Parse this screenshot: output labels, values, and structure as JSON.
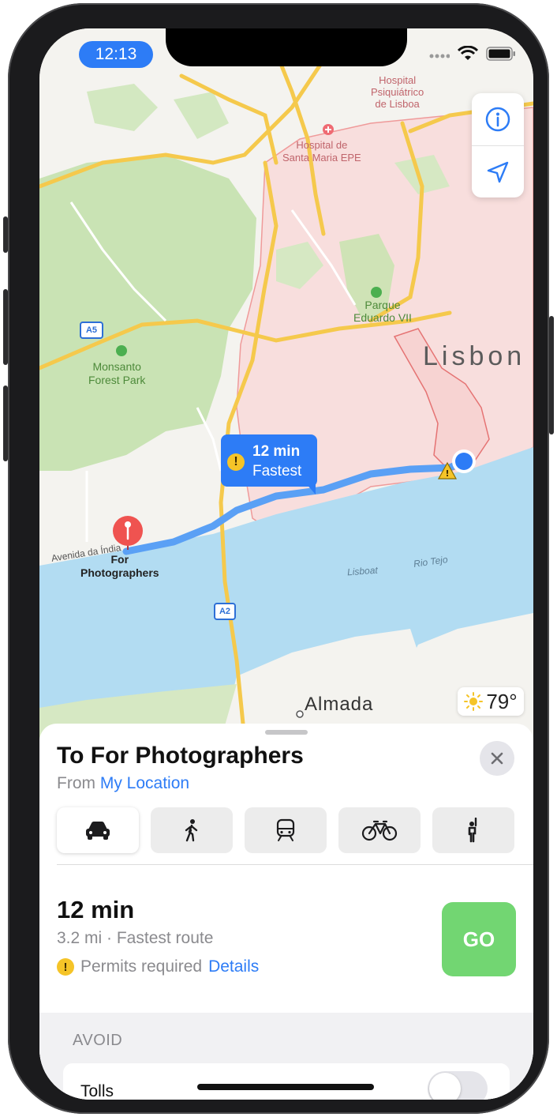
{
  "status_bar": {
    "time": "12:13"
  },
  "map": {
    "labels": {
      "hospital_psiquiatrico": "Hospital Psiquiátrico de Lisboa",
      "hospital_psiquiatrico_l1": "Hospital",
      "hospital_psiquiatrico_l2": "Psiquiátrico",
      "hospital_psiquiatrico_l3": "de Lisboa",
      "hospital_santa_maria_l1": "Hospital de",
      "hospital_santa_maria_l2": "Santa Maria EPE",
      "parque_l1": "Parque",
      "parque_l2": "Eduardo VII",
      "lisbon": "Lisbon",
      "monsanto_l1": "Monsanto",
      "monsanto_l2": "Forest Park",
      "avenida": "Avenida da Índia",
      "dest_l1": "For",
      "dest_l2": "Photographers",
      "lisboat": "Lisboat",
      "rio_tejo": "Rio Tejo",
      "almada": "Almada",
      "a5": "A5",
      "a2": "A2"
    },
    "route_callout": {
      "time": "12 min",
      "label": "Fastest"
    },
    "weather": {
      "temperature": "79°",
      "icon": "sun-icon"
    },
    "controls": {
      "info_icon": "info-icon",
      "location_icon": "location-arrow-icon"
    }
  },
  "sheet": {
    "title": "To For Photographers",
    "from_prefix": "From",
    "from_link": "My Location",
    "modes": [
      {
        "name": "drive",
        "icon": "car-icon",
        "active": true
      },
      {
        "name": "walk",
        "icon": "walk-icon",
        "active": false
      },
      {
        "name": "transit",
        "icon": "train-icon",
        "active": false
      },
      {
        "name": "cycle",
        "icon": "bicycle-icon",
        "active": false
      },
      {
        "name": "rideshare",
        "icon": "hail-icon",
        "active": false
      }
    ],
    "route": {
      "time": "12 min",
      "summary": "3.2 mi · Fastest route",
      "permit_text": "Permits required",
      "permit_link": "Details",
      "go_label": "GO"
    },
    "avoid": {
      "header": "AVOID",
      "tolls_label": "Tolls",
      "tolls_on": false
    }
  },
  "colors": {
    "accent_blue": "#2d7cf6",
    "go_green": "#72d672",
    "warning_yellow": "#f5c428",
    "water": "#b2dcf2",
    "park_green": "#c9e3b4",
    "city_pink": "#f8dedd",
    "road_yellow": "#f5c94c"
  }
}
